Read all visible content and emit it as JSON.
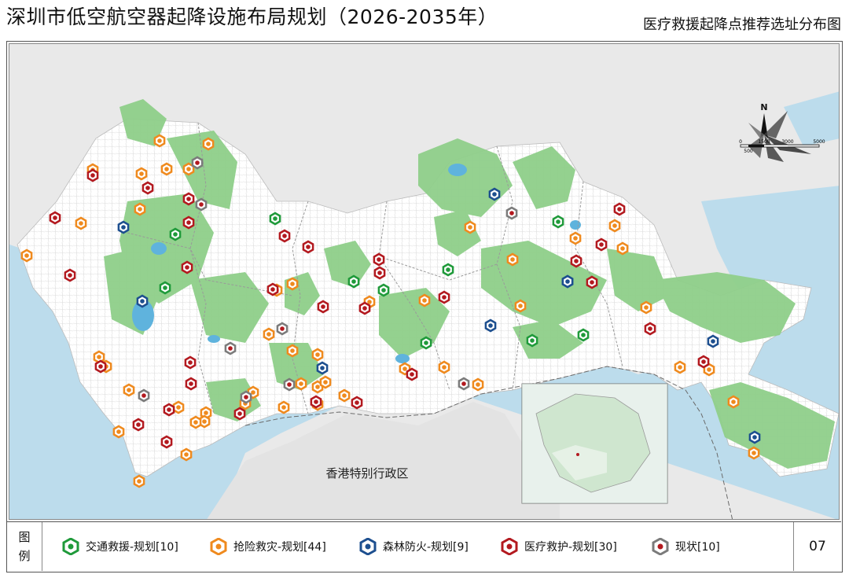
{
  "title": "深圳市低空航空器起降设施布局规划（2026-2035年）",
  "subtitle": "医疗救援起降点推荐选址分布图",
  "map": {
    "region_label": "香港特别行政区",
    "north_label": "N",
    "scale_labels": [
      "0",
      "500",
      "1500",
      "3000",
      "5000"
    ]
  },
  "legend": {
    "head": [
      "图",
      "例"
    ],
    "page_number": "07",
    "items": [
      {
        "key": "traffic",
        "label": "交通救援-规划[10]",
        "color": "#1f9a3a"
      },
      {
        "key": "rescue",
        "label": "抢险救灾-规划[44]",
        "color": "#ef8a1e"
      },
      {
        "key": "forest",
        "label": "森林防火-规划[9]",
        "color": "#1d4f8f"
      },
      {
        "key": "medical",
        "label": "医疗救护-规划[30]",
        "color": "#b3191f"
      },
      {
        "key": "existing",
        "label": "现状[10]",
        "color": "#7b7b7b"
      }
    ]
  }
}
